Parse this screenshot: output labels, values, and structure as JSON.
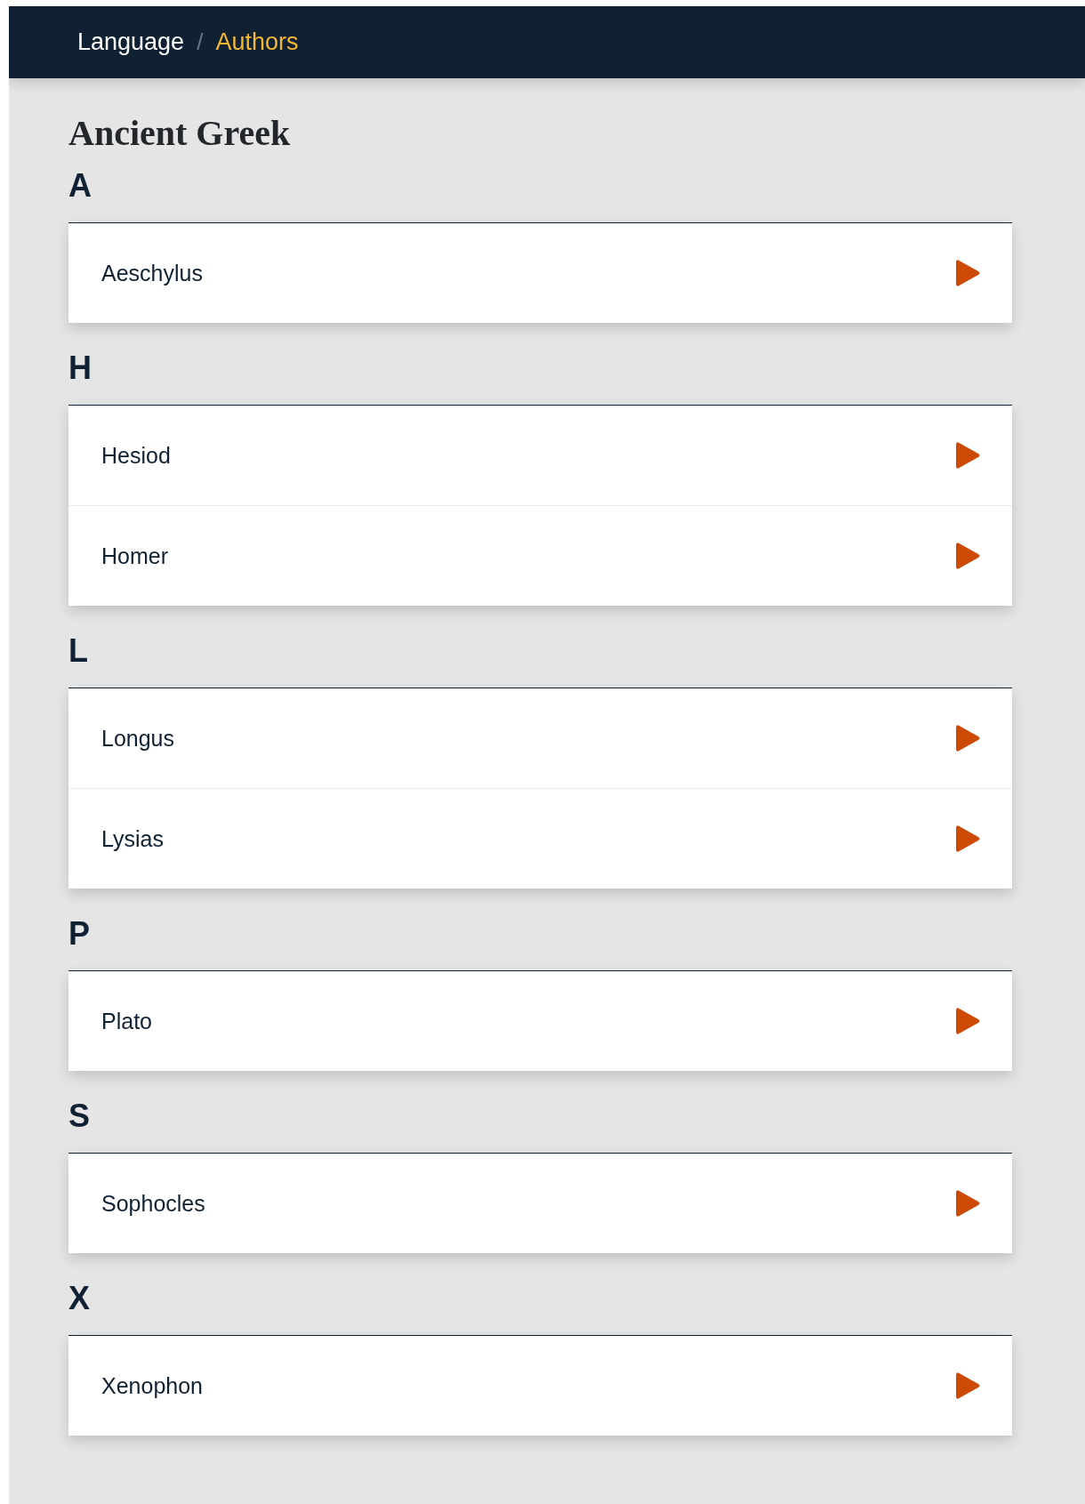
{
  "breadcrumb": [
    {
      "label": "Language",
      "selected": false
    },
    {
      "label": "Authors",
      "selected": true
    }
  ],
  "breadcrumb_separator": "/",
  "title": "Ancient Greek",
  "groups": [
    {
      "letter": "A",
      "authors": [
        "Aeschylus"
      ]
    },
    {
      "letter": "H",
      "authors": [
        "Hesiod",
        "Homer"
      ]
    },
    {
      "letter": "L",
      "authors": [
        "Longus",
        "Lysias"
      ]
    },
    {
      "letter": "P",
      "authors": [
        "Plato"
      ]
    },
    {
      "letter": "S",
      "authors": [
        "Sophocles"
      ]
    },
    {
      "letter": "X",
      "authors": [
        "Xenophon"
      ]
    }
  ]
}
